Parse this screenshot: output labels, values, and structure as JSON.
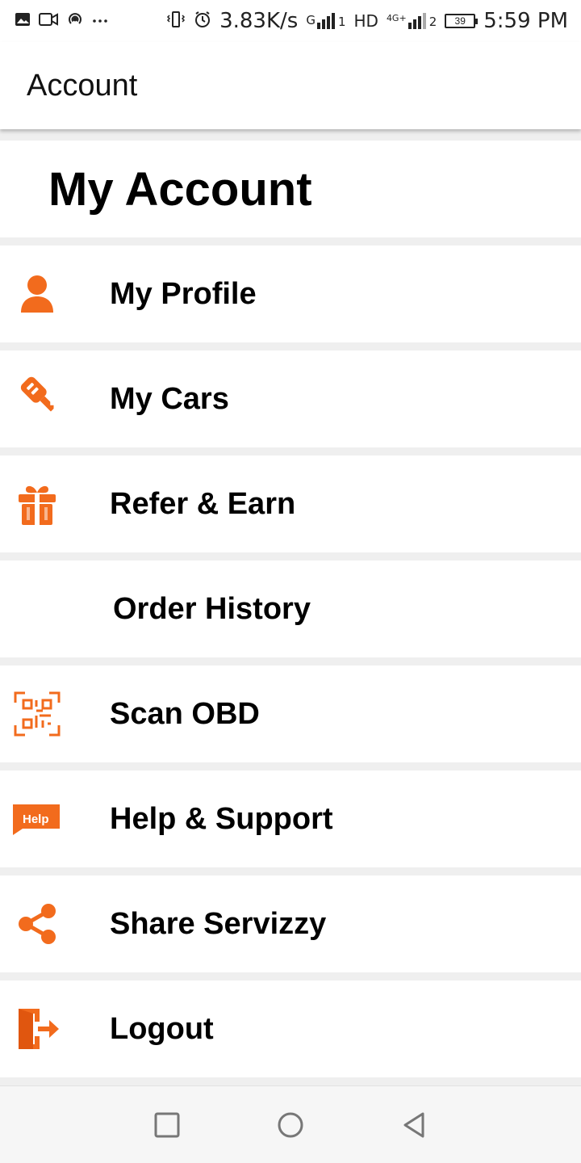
{
  "status_bar": {
    "net_speed": "3.83K/s",
    "sim1_label": "G",
    "sim1_sub": "1",
    "hd_label": "HD",
    "sim2_label": "4G+",
    "sim2_sub": "2",
    "battery": "39",
    "time": "5:59 PM",
    "icons": [
      "image-icon",
      "video-icon",
      "hotspot-icon",
      "more-icon",
      "vibrate-icon",
      "alarm-icon",
      "signal-icon",
      "battery-icon"
    ]
  },
  "app_bar": {
    "title": "Account"
  },
  "header": {
    "title": "My Account"
  },
  "menu": {
    "items": [
      {
        "label": "My Profile",
        "icon": "user-icon"
      },
      {
        "label": "My Cars",
        "icon": "car-key-icon"
      },
      {
        "label": "Refer & Earn",
        "icon": "gift-icon"
      },
      {
        "label": "Order History",
        "icon": ""
      },
      {
        "label": "Scan OBD",
        "icon": "qr-scan-icon"
      },
      {
        "label": "Help & Support",
        "icon": "help-icon"
      },
      {
        "label": "Share Servizzy",
        "icon": "share-icon"
      },
      {
        "label": "Logout",
        "icon": "logout-icon"
      }
    ],
    "help_badge": "Help"
  },
  "nav_bar": {
    "icons": [
      "recents-icon",
      "home-icon",
      "back-icon"
    ]
  },
  "colors": {
    "accent": "#f26b1d",
    "background": "#efefef",
    "card": "#ffffff"
  }
}
